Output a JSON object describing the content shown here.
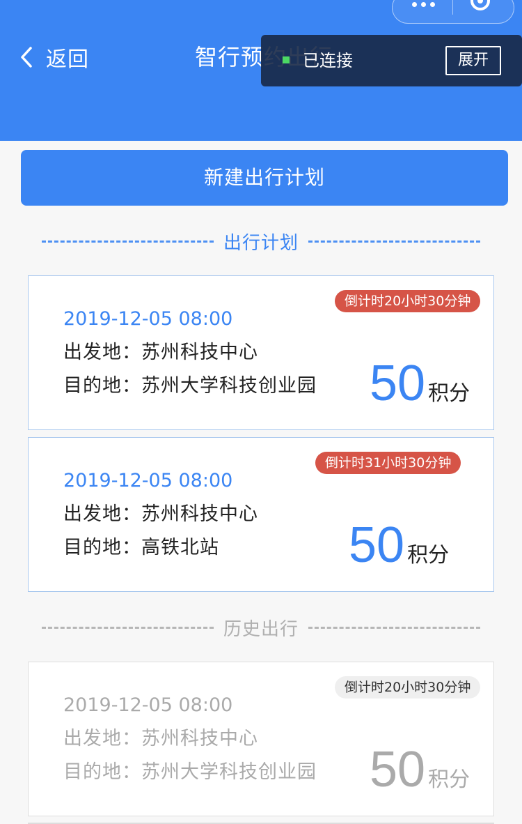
{
  "header": {
    "back_label": "返回",
    "title": "智行预约出行"
  },
  "debug_panel": {
    "status": "已连接",
    "expand_label": "展开",
    "led_color": "#4cd964"
  },
  "new_plan_button": "新建出行计划",
  "sections": {
    "active": "出行计划",
    "history": "历史出行"
  },
  "plans": [
    {
      "countdown": "倒计时20小时30分钟",
      "datetime": "2019-12-05 08:00",
      "departure_label": "出发地：",
      "departure": "苏州科技中心",
      "destination_label": "目的地：",
      "destination": "苏州大学科技创业园",
      "points": "50",
      "points_unit": "积分"
    },
    {
      "countdown": "倒计时31小时30分钟",
      "datetime": "2019-12-05 08:00",
      "departure_label": "出发地：",
      "departure": "苏州科技中心",
      "destination_label": "目的地：",
      "destination": "高铁北站",
      "points": "50",
      "points_unit": "积分"
    }
  ],
  "history": [
    {
      "countdown": "倒计时20小时30分钟",
      "datetime": "2019-12-05 08:00",
      "departure_label": "出发地：",
      "departure": "苏州科技中心",
      "destination_label": "目的地：",
      "destination": "苏州大学科技创业园",
      "points": "50",
      "points_unit": "积分"
    }
  ],
  "colors": {
    "primary": "#3b85f3",
    "countdown_badge": "#d65447",
    "muted": "#aaaaaa"
  },
  "icons": [
    "back-chevron-icon",
    "more-dots-icon",
    "close-target-icon",
    "connection-led-icon"
  ]
}
